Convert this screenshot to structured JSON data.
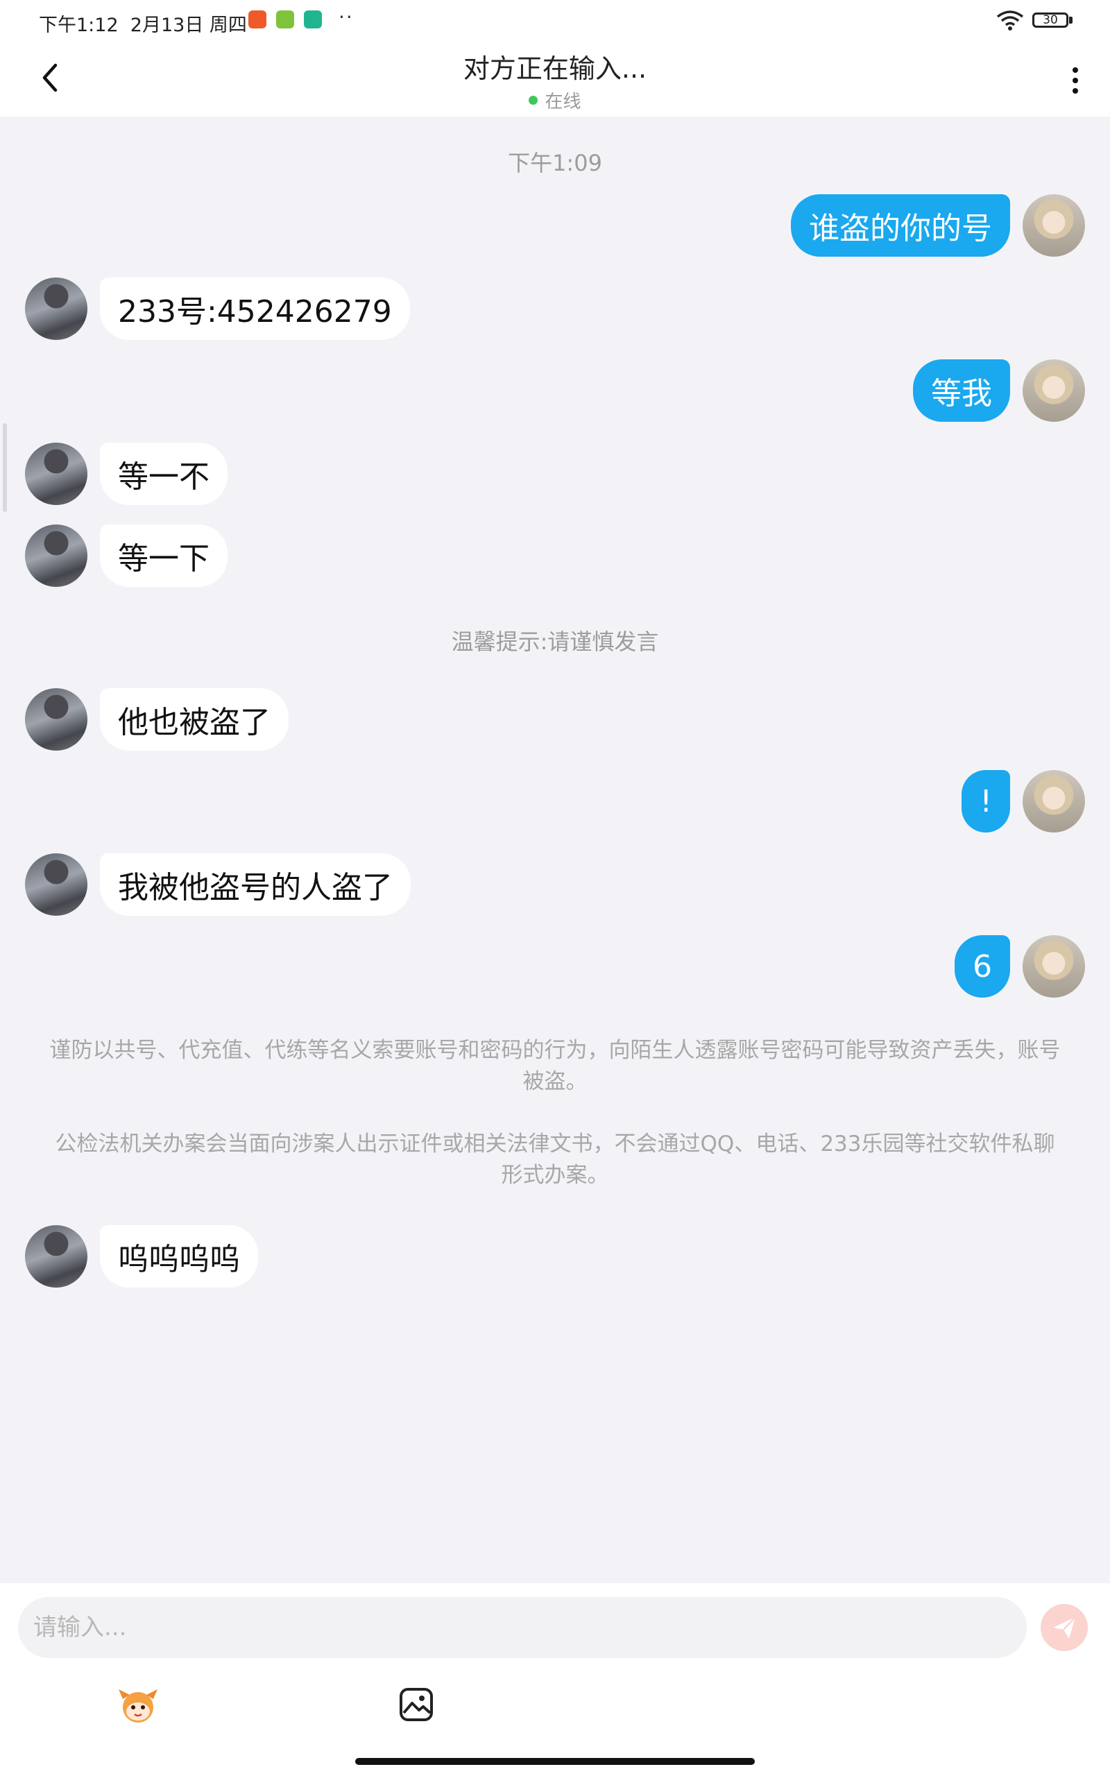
{
  "status_bar": {
    "time_date": "下午1:12  2月13日 周四",
    "more_dots": "··",
    "battery": "30",
    "app_icon_colors": [
      "#f05a28",
      "#7ec43a",
      "#1fb58f"
    ]
  },
  "header": {
    "title": "对方正在输入...",
    "status": "在线",
    "status_color": "#3cc95a"
  },
  "chat": {
    "time": "下午1:09",
    "tip": "温馨提示:请谨慎发言",
    "messages": [
      {
        "side": "out",
        "text": "谁盗的你的号"
      },
      {
        "side": "in",
        "text": "233号:452426279"
      },
      {
        "side": "out",
        "text": "等我"
      },
      {
        "side": "in",
        "text": "等一不"
      },
      {
        "side": "in",
        "text": "等一下"
      },
      {
        "side": "in",
        "text": "他也被盗了"
      },
      {
        "side": "out",
        "text": "!"
      },
      {
        "side": "in",
        "text": "我被他盗号的人盗了"
      },
      {
        "side": "out",
        "text": "6"
      },
      {
        "side": "in",
        "text": "呜呜呜呜"
      }
    ],
    "notice_1": "谨防以共号、代充值、代练等名义索要账号和密码的行为，向陌生人透露账号密码可能导致资产丢失，账号被盗。",
    "notice_2": "公检法机关办案会当面向涉案人出示证件或相关法律文书，不会通过QQ、电话、233乐园等社交软件私聊形式办案。"
  },
  "input": {
    "placeholder": "请输入..."
  },
  "colors": {
    "outgoing_bubble": "#1aa8ef",
    "incoming_bubble": "#ffffff",
    "background": "#f3f3f7",
    "send_button": "#fbd3cf"
  },
  "icons": [
    "back-arrow-icon",
    "more-vertical-icon",
    "wifi-icon",
    "battery-icon",
    "send-icon",
    "emoji-icon",
    "image-icon"
  ]
}
